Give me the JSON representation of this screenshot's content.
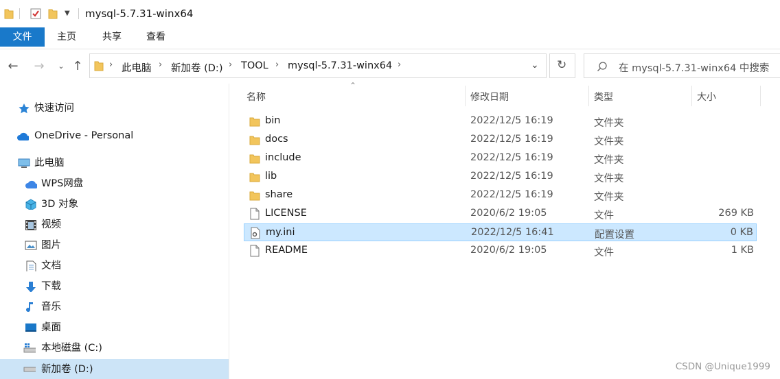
{
  "window": {
    "title": "mysql-5.7.31-winx64"
  },
  "ribbon": {
    "tabs": [
      "文件",
      "主页",
      "共享",
      "查看"
    ]
  },
  "address": {
    "crumbs": [
      "此电脑",
      "新加卷 (D:)",
      "TOOL",
      "mysql-5.7.31-winx64"
    ]
  },
  "search": {
    "placeholder": "在 mysql-5.7.31-winx64 中搜索"
  },
  "sidebar": {
    "items": [
      "快速访问",
      "OneDrive - Personal",
      "此电脑",
      "WPS网盘",
      "3D 对象",
      "视频",
      "图片",
      "文档",
      "下载",
      "音乐",
      "桌面",
      "本地磁盘 (C:)",
      "新加卷 (D:)"
    ]
  },
  "columns": {
    "name": "名称",
    "date": "修改日期",
    "type": "类型",
    "size": "大小"
  },
  "files": [
    {
      "name": "bin",
      "date": "2022/12/5 16:19",
      "type": "文件夹",
      "size": ""
    },
    {
      "name": "docs",
      "date": "2022/12/5 16:19",
      "type": "文件夹",
      "size": ""
    },
    {
      "name": "include",
      "date": "2022/12/5 16:19",
      "type": "文件夹",
      "size": ""
    },
    {
      "name": "lib",
      "date": "2022/12/5 16:19",
      "type": "文件夹",
      "size": ""
    },
    {
      "name": "share",
      "date": "2022/12/5 16:19",
      "type": "文件夹",
      "size": ""
    },
    {
      "name": "LICENSE",
      "date": "2020/6/2 19:05",
      "type": "文件",
      "size": "269 KB"
    },
    {
      "name": "my.ini",
      "date": "2022/12/5 16:41",
      "type": "配置设置",
      "size": "0 KB"
    },
    {
      "name": "README",
      "date": "2020/6/2 19:05",
      "type": "文件",
      "size": "1 KB"
    }
  ],
  "watermark": "CSDN @Unique1999",
  "colors": {
    "accent": "#1979ca",
    "selection": "#cce8ff",
    "folder": "#f2c55c"
  }
}
